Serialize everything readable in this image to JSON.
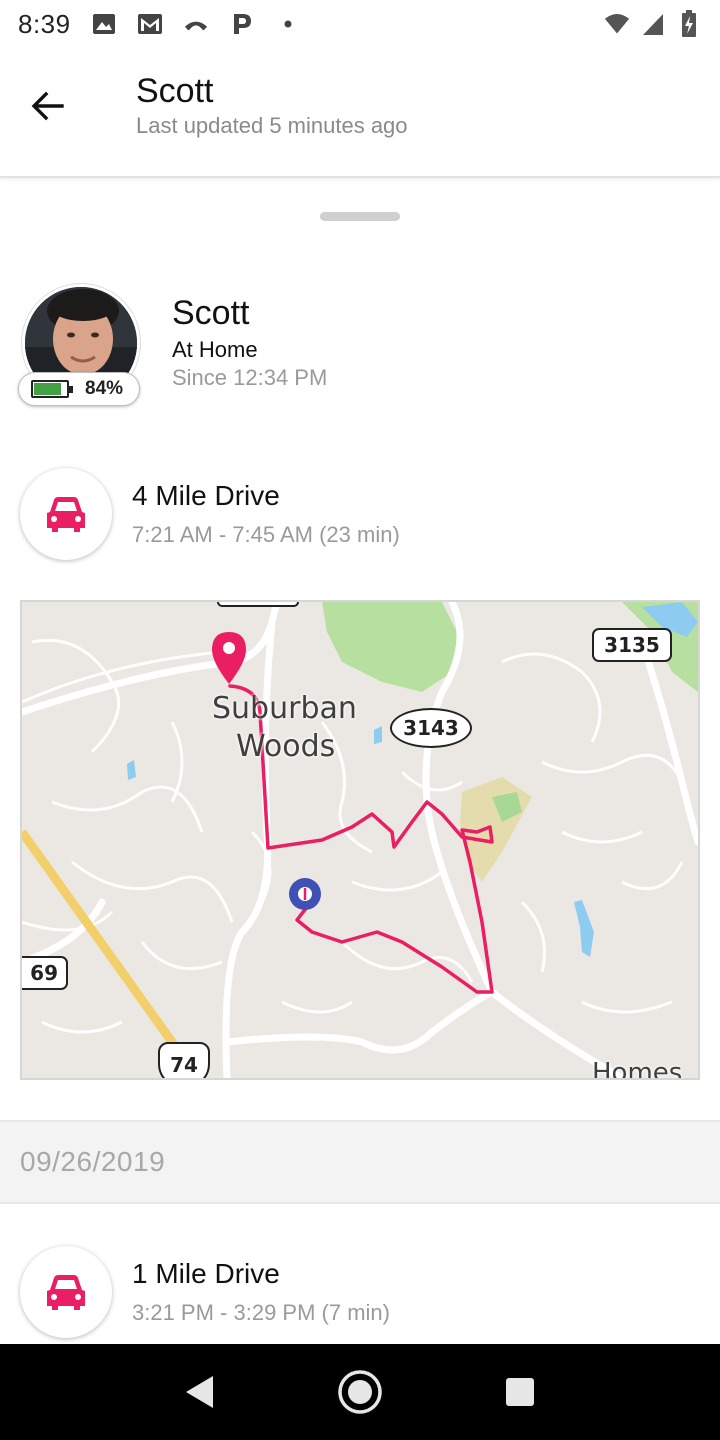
{
  "status_bar": {
    "time": "8:39",
    "left_icons": [
      "image-icon",
      "gmail-icon",
      "phone-call-icon",
      "parking-p-icon",
      "dot-icon"
    ],
    "right_icons": [
      "wifi-icon",
      "signal-icon",
      "battery-charging-icon"
    ]
  },
  "app_bar": {
    "title": "Scott",
    "subtitle": "Last updated 5 minutes ago"
  },
  "person": {
    "name": "Scott",
    "status": "At Home",
    "since": "Since 12:34 PM",
    "battery_percent": "84%",
    "battery_level": 0.84
  },
  "drives": [
    {
      "title": "4 Mile Drive",
      "time": "7:21 AM - 7:45 AM (23 min)"
    },
    {
      "title": "1 Mile Drive",
      "time": "3:21 PM - 3:29 PM (7 min)"
    }
  ],
  "map": {
    "place_label_line1": "Suburban",
    "place_label_line2": "Woods",
    "route_labels": [
      "3135",
      "3143",
      "69",
      "74"
    ],
    "bottom_right_partial": "Homes",
    "route_color": "#e91e63",
    "pin_color": "#e91e63",
    "end_marker_color": "#3f51b5"
  },
  "date_separator": "09/26/2019",
  "colors": {
    "accent": "#e91e63",
    "battery_green": "#43a047"
  }
}
